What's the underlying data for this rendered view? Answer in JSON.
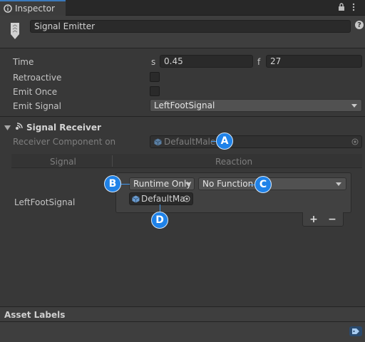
{
  "tab": {
    "title": "Inspector",
    "lock_icon": "lock-icon",
    "menu_icon": "kebab-menu-icon"
  },
  "header": {
    "object_name": "Signal Emitter",
    "help": "?"
  },
  "props": {
    "time": {
      "label": "Time",
      "s_label": "s",
      "s_value": "0.45",
      "f_label": "f",
      "f_value": "27"
    },
    "retroactive": {
      "label": "Retroactive",
      "checked": false
    },
    "emit_once": {
      "label": "Emit Once",
      "checked": false
    },
    "emit_signal": {
      "label": "Emit Signal",
      "value": "LeftFootSignal"
    }
  },
  "receiver": {
    "title": "Signal Receiver",
    "component_label": "Receiver Component on",
    "component_value": "DefaultMale",
    "col_signal": "Signal",
    "col_reaction": "Reaction",
    "row_signal": "LeftFootSignal",
    "runtime_mode": "Runtime Only",
    "function": "No Function",
    "object": "DefaultMa",
    "add": "+",
    "remove": "−"
  },
  "callouts": {
    "a": "A",
    "b": "B",
    "c": "C",
    "d": "D"
  },
  "footer": {
    "title": "Asset Labels"
  },
  "colors": {
    "accent": "#1f82e8",
    "background": "#383838",
    "field": "#2a2a2a"
  }
}
